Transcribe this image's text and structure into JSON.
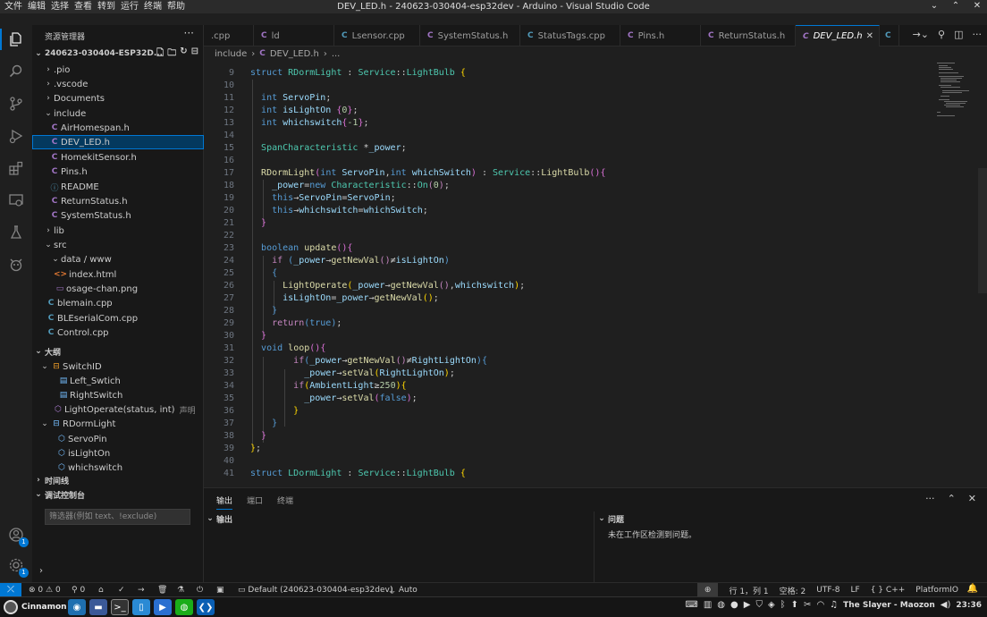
{
  "window": {
    "title": "DEV_LED.h - 240623-030404-esp32dev - Arduino - Visual Studio Code",
    "menus": [
      "文件",
      "编辑",
      "选择",
      "查看",
      "转到",
      "运行",
      "终端",
      "帮助"
    ]
  },
  "activity": {
    "icons": [
      "explorer-icon",
      "search-icon",
      "source-control-icon",
      "run-debug-icon",
      "extensions-icon",
      "remote-explorer-icon",
      "testing-icon",
      "platformio-icon"
    ],
    "bottom_icons": [
      "account-icon",
      "manage-icon"
    ],
    "account_badge": "1",
    "manage_badge": "1"
  },
  "sidebar": {
    "title": "资源管理器",
    "project": "240623-030404-ESP32D...",
    "files": [
      {
        "label": ".pio",
        "type": "folder",
        "collapsed": true
      },
      {
        "label": ".vscode",
        "type": "folder",
        "collapsed": true
      },
      {
        "label": "Documents",
        "type": "folder",
        "collapsed": true
      },
      {
        "label": "include",
        "type": "folder",
        "collapsed": false
      },
      {
        "label": "AirHomespan.h",
        "type": "c"
      },
      {
        "label": "DEV_LED.h",
        "type": "c",
        "selected": true
      },
      {
        "label": "HomekitSensor.h",
        "type": "c"
      },
      {
        "label": "Pins.h",
        "type": "c"
      },
      {
        "label": "README",
        "type": "info"
      },
      {
        "label": "ReturnStatus.h",
        "type": "c"
      },
      {
        "label": "SystemStatus.h",
        "type": "c"
      },
      {
        "label": "lib",
        "type": "folder",
        "collapsed": true
      },
      {
        "label": "src",
        "type": "folder",
        "collapsed": false
      },
      {
        "label": "data / www",
        "type": "folder",
        "collapsed": false
      },
      {
        "label": "index.html",
        "type": "html"
      },
      {
        "label": "osage-chan.png",
        "type": "png"
      },
      {
        "label": "blemain.cpp",
        "type": "cpp"
      },
      {
        "label": "BLEserialCom.cpp",
        "type": "cpp"
      },
      {
        "label": "Control.cpp",
        "type": "cpp"
      }
    ],
    "outline_title": "大纲",
    "outline": [
      {
        "label": "SwitchID",
        "kind": "class"
      },
      {
        "label": "Left_Swtich",
        "kind": "field"
      },
      {
        "label": "RightSwitch",
        "kind": "field"
      },
      {
        "label": "LightOperate(status, int)",
        "kind": "function",
        "desc": "声明"
      },
      {
        "label": "RDormLight",
        "kind": "class"
      },
      {
        "label": "ServoPin",
        "kind": "field"
      },
      {
        "label": "isLightOn",
        "kind": "field"
      },
      {
        "label": "whichswitch",
        "kind": "field"
      }
    ],
    "timeline_title": "时间线",
    "debug_console_title": "调试控制台",
    "filter_placeholder": "筛选器(例如 text、!exclude)"
  },
  "tabs": [
    {
      "label": ".cpp",
      "icon": "cpp"
    },
    {
      "label": "ld",
      "icon": "c"
    },
    {
      "label": "Lsensor.cpp",
      "icon": "cpp"
    },
    {
      "label": "SystemStatus.h",
      "icon": "c"
    },
    {
      "label": "StatusTags.cpp",
      "icon": "cpp"
    },
    {
      "label": "Pins.h",
      "icon": "c"
    },
    {
      "label": "ReturnStatus.h",
      "icon": "c"
    },
    {
      "label": "DEV_LED.h",
      "icon": "c",
      "active": true
    }
  ],
  "breadcrumb": [
    "include",
    "DEV_LED.h",
    "..."
  ],
  "editor": {
    "line_numbers": [
      "9",
      "10",
      "11",
      "12",
      "13",
      "14",
      "15",
      "16",
      "17",
      "18",
      "19",
      "20",
      "21",
      "22",
      "23",
      "24",
      "25",
      "26",
      "27",
      "28",
      "29",
      "30",
      "31",
      "32",
      "33",
      "34",
      "35",
      "36",
      "37",
      "38",
      "39",
      "40",
      "41"
    ]
  },
  "panel": {
    "tabs": [
      "输出",
      "端口",
      "终端"
    ],
    "output_title": "输出",
    "problems_title": "问题",
    "problems_message": "未在工作区检测到问题。"
  },
  "statusbar": {
    "errors": "0",
    "warnings": "0",
    "ports": "0",
    "env": "Default (240623-030404-esp32dev)",
    "auto": "Auto",
    "cursor": "行 1，列 1",
    "spaces": "空格: 2",
    "encoding": "UTF-8",
    "eol": "LF",
    "language": "C++",
    "platform": "PlatformIO"
  },
  "taskbar": {
    "start_label": "Cinnamon",
    "now_playing": "The Slayer - Maozon",
    "clock": "23:36"
  }
}
